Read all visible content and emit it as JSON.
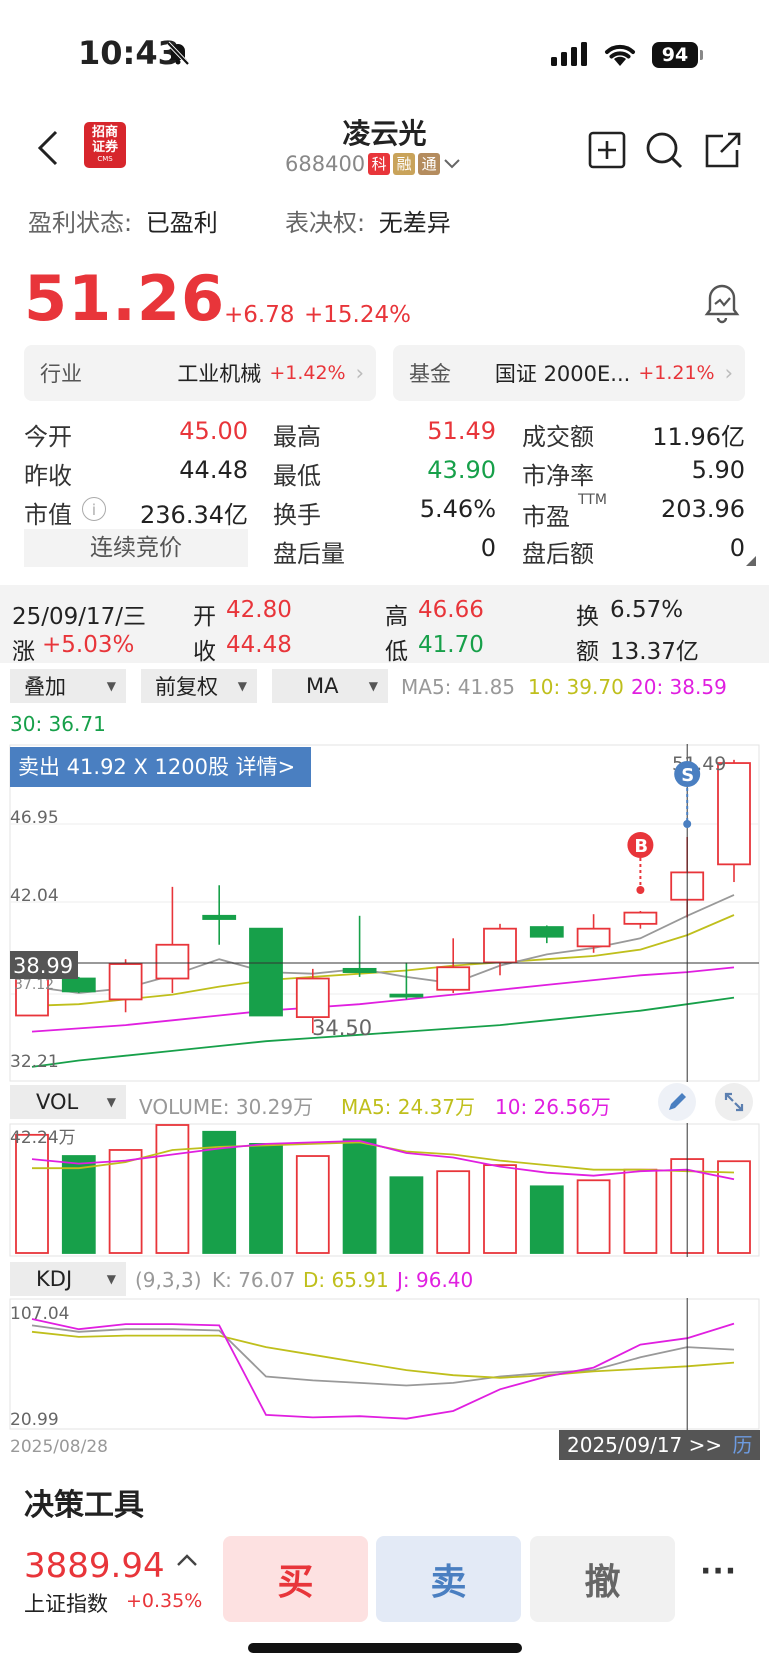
{
  "status_bar": {
    "time": "10:43",
    "battery": "94"
  },
  "header": {
    "title": "凌云光",
    "code": "688400",
    "tags": [
      "科",
      "融",
      "通"
    ],
    "broker_logo_text": "招商证券",
    "broker_logo_sub": "CMS"
  },
  "info": {
    "profit_label": "盈利状态:",
    "profit_value": "已盈利",
    "vote_label": "表决权:",
    "vote_value": "无差异"
  },
  "price": {
    "last": "51.26",
    "change": "+6.78",
    "change_pct": "+15.24%"
  },
  "chips": {
    "industry_label": "行业",
    "industry_name": "工业机械",
    "industry_pct": "+1.42%",
    "fund_label": "基金",
    "fund_name": "国证 2000E...",
    "fund_pct": "+1.21%"
  },
  "quote": {
    "open_label": "今开",
    "open": "45.00",
    "high_label": "最高",
    "high": "51.49",
    "amount_label": "成交额",
    "amount": "11.96亿",
    "prev_label": "昨收",
    "prev": "44.48",
    "low_label": "最低",
    "low": "43.90",
    "pb_label": "市净率",
    "pb": "5.90",
    "mcap_label": "市值",
    "mcap": "236.34亿",
    "turnover_label": "换手",
    "turnover": "5.46%",
    "pe_label": "市盈",
    "pe_sup": "TTM",
    "pe": "203.96",
    "auction_label": "连续竞价",
    "after_vol_label": "盘后量",
    "after_vol": "0",
    "after_amt_label": "盘后额",
    "after_amt": "0"
  },
  "day_detail": {
    "date": "25/09/17/三",
    "open_label": "开",
    "open": "42.80",
    "high_label": "高",
    "high": "46.66",
    "turn_label": "换",
    "turn": "6.57%",
    "chg_label": "涨",
    "chg": "+5.03%",
    "close_label": "收",
    "close": "44.48",
    "low_label": "低",
    "low": "41.70",
    "amt_label": "额",
    "amt": "13.37亿"
  },
  "controls": {
    "overlay": "叠加",
    "adjust": "前复权",
    "indicator": "MA",
    "vol": "VOL",
    "kdj": "KDJ"
  },
  "ma_legend": {
    "ma5": "MA5: 41.85",
    "ma10": "10: 39.70",
    "ma20": "20: 38.59",
    "ma30": "30: 36.71"
  },
  "trade_tag": "卖出 41.92 X 1200股 详情>",
  "vol_legend": {
    "volume": "VOLUME: 30.29万",
    "ma5": "MA5: 24.37万",
    "ma10": "10: 26.56万"
  },
  "kdj_legend": {
    "params": "(9,3,3)",
    "k": "K: 76.07",
    "d": "D: 65.91",
    "j": "J: 96.40"
  },
  "chart_labels": {
    "y_top": "46.95",
    "y_mid": "42.04",
    "y_cross": "38.99",
    "y_hidden": "37.12",
    "y_bottom": "32.21",
    "max_label": "51.49",
    "min_label": "34.50",
    "marker_b": "B",
    "marker_s": "S",
    "vol_max": "42.24万",
    "kdj_max": "107.04",
    "kdj_min": "20.99",
    "date_start": "2025/08/28",
    "date_end": "2025/09/17 >>",
    "date_end_suffix": "历"
  },
  "bottom": {
    "tools_title": "决策工具",
    "index_value": "3889.94",
    "index_name": "上证指数",
    "index_pct": "+0.35%",
    "buy": "买",
    "sell": "卖",
    "cancel": "撤",
    "more": "···"
  },
  "colors": {
    "up": "#e8353a",
    "down": "#17a04a",
    "ma5": "#bfbf1c",
    "ma10": "#e01fe0",
    "ma20": "#17a04a",
    "ma30": "#999999",
    "trade_tag": "#4a7fc1"
  },
  "chart_data": {
    "type": "candlestick",
    "dates": [
      "2025/08/28",
      "2025/09/17"
    ],
    "candles": [
      {
        "o": 38.0,
        "h": 38.6,
        "l": 35.6,
        "c": 35.6,
        "up": true
      },
      {
        "o": 37.9,
        "h": 38.0,
        "l": 37.0,
        "c": 37.1,
        "up": false
      },
      {
        "o": 36.6,
        "h": 39.1,
        "l": 35.8,
        "c": 38.8,
        "up": true
      },
      {
        "o": 37.9,
        "h": 43.6,
        "l": 37.0,
        "c": 40.0,
        "up": true
      },
      {
        "o": 41.6,
        "h": 43.7,
        "l": 40.0,
        "c": 41.8,
        "up": false
      },
      {
        "o": 41.0,
        "h": 41.0,
        "l": 35.6,
        "c": 35.6,
        "up": false
      },
      {
        "o": 35.5,
        "h": 38.5,
        "l": 34.5,
        "c": 37.9,
        "up": true
      },
      {
        "o": 38.3,
        "h": 41.8,
        "l": 38.0,
        "c": 38.5,
        "up": false
      },
      {
        "o": 36.8,
        "h": 38.9,
        "l": 36.6,
        "c": 36.9,
        "up": false
      },
      {
        "o": 37.2,
        "h": 40.4,
        "l": 37.0,
        "c": 38.6,
        "up": true
      },
      {
        "o": 38.9,
        "h": 41.3,
        "l": 38.1,
        "c": 41.0,
        "up": true
      },
      {
        "o": 41.1,
        "h": 41.2,
        "l": 40.1,
        "c": 40.5,
        "up": false
      },
      {
        "o": 39.9,
        "h": 41.9,
        "l": 39.5,
        "c": 41.0,
        "up": true
      },
      {
        "o": 41.3,
        "h": 42.1,
        "l": 41.0,
        "c": 42.0,
        "up": true
      },
      {
        "o": 42.8,
        "h": 46.7,
        "l": 41.7,
        "c": 44.5,
        "up": true
      },
      {
        "o": 45.0,
        "h": 51.5,
        "l": 43.9,
        "c": 51.3,
        "up": true
      }
    ],
    "ma5": [
      36.2,
      36.3,
      36.6,
      36.9,
      37.4,
      37.8,
      38.0,
      38.2,
      38.4,
      38.7,
      38.9,
      39.1,
      39.3,
      39.7,
      40.6,
      41.85
    ],
    "ma10": [
      34.6,
      34.8,
      35.0,
      35.3,
      35.6,
      35.9,
      36.1,
      36.3,
      36.6,
      36.9,
      37.2,
      37.5,
      37.8,
      38.1,
      38.3,
      38.59
    ],
    "ma20": [
      32.4,
      32.8,
      33.1,
      33.4,
      33.7,
      34.0,
      34.2,
      34.4,
      34.6,
      34.8,
      35.0,
      35.3,
      35.6,
      35.9,
      36.3,
      36.71
    ],
    "ma30": [
      37.4,
      37.0,
      37.3,
      38.1,
      39.1,
      38.3,
      38.2,
      38.5,
      38.0,
      37.6,
      38.7,
      39.4,
      39.8,
      40.4,
      41.8,
      43.1
    ],
    "volume": [
      39.0,
      32.0,
      34.0,
      42.24,
      40.0,
      36.0,
      32.0,
      37.5,
      25.0,
      27.0,
      29.0,
      22.0,
      24.0,
      27.5,
      31.0,
      30.29
    ],
    "volume_ma5": [
      28.0,
      28.0,
      30.0,
      34.0,
      35.0,
      35.5,
      36.0,
      36.5,
      33.5,
      32.5,
      30.5,
      29.0,
      27.5,
      27.5,
      27.0,
      26.56
    ],
    "volume_ma10": [
      31.0,
      29.5,
      30.5,
      32.5,
      34.5,
      36.0,
      36.5,
      37.0,
      33.0,
      31.5,
      28.5,
      26.5,
      25.5,
      27.0,
      27.5,
      24.37
    ],
    "k": [
      95,
      90,
      92,
      92,
      91,
      55,
      52,
      50,
      48,
      50,
      55,
      58,
      60,
      70,
      78,
      76.07
    ],
    "d": [
      90,
      86,
      87,
      87,
      87,
      78,
      72,
      66,
      60,
      56,
      54,
      56,
      59,
      61,
      63,
      65.91
    ],
    "j": [
      100,
      92,
      96,
      96,
      95,
      25,
      23,
      24,
      22,
      28,
      45,
      55,
      62,
      80,
      85,
      96.4
    ],
    "price_range": [
      32.21,
      51.49
    ],
    "kdj_range": [
      20.99,
      107.04
    ]
  }
}
